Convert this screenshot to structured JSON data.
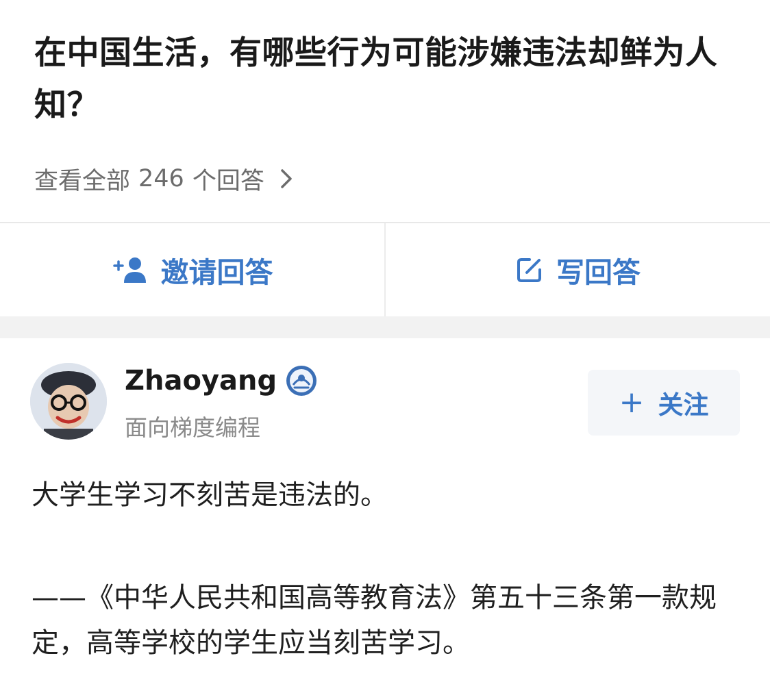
{
  "question": {
    "title": "在中国生活，有哪些行为可能涉嫌违法却鲜为人知？",
    "view_all_prefix": "查看全部",
    "answer_count": "246",
    "view_all_suffix": "个回答"
  },
  "actions": {
    "invite_label": "邀请回答",
    "write_label": "写回答",
    "invite_icon": "add-user-icon",
    "write_icon": "edit-icon",
    "accent_color": "#3b78c7"
  },
  "answer": {
    "author": {
      "name": "Zhaoyang",
      "bio": "面向梯度编程",
      "badge_icon": "verified-badge-icon"
    },
    "follow": {
      "plus": "+",
      "label": "关注"
    },
    "paragraphs": [
      "大学生学习不刻苦是违法的。",
      "——《中华人民共和国高等教育法》第五十三条第一款规定，高等学校的学生应当刻苦学习。"
    ]
  }
}
